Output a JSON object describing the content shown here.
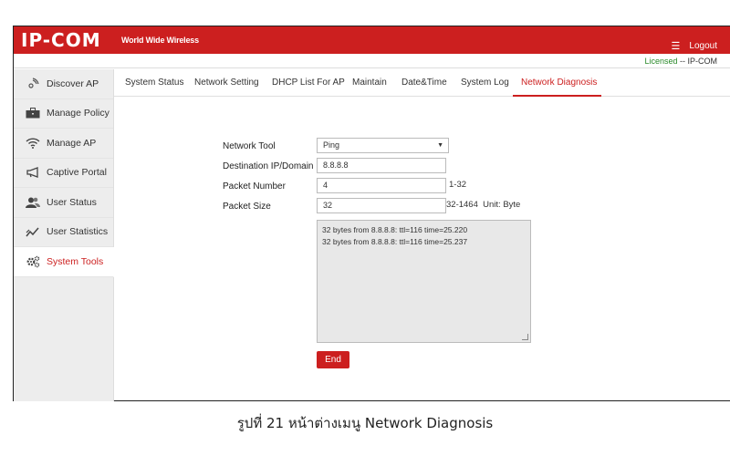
{
  "header": {
    "logo": "IP-COM",
    "tagline": "World Wide Wireless",
    "menu_icon": "hamburger-icon",
    "logout": "Logout"
  },
  "license": {
    "label": "Licensed",
    "separator": "--",
    "brand": "IP-COM"
  },
  "sidebar": {
    "items": [
      {
        "label": "Discover AP",
        "icon": "discover-ap-icon"
      },
      {
        "label": "Manage Policy",
        "icon": "briefcase-icon"
      },
      {
        "label": "Manage AP",
        "icon": "wifi-icon"
      },
      {
        "label": "Captive Portal",
        "icon": "megaphone-icon"
      },
      {
        "label": "User Status",
        "icon": "users-icon"
      },
      {
        "label": "User Statistics",
        "icon": "chart-line-icon"
      },
      {
        "label": "System Tools",
        "icon": "gears-icon",
        "active": true
      }
    ]
  },
  "tabs": [
    {
      "label": "System Status"
    },
    {
      "label": "Network Setting"
    },
    {
      "label": "DHCP List For AP"
    },
    {
      "label": "Maintain"
    },
    {
      "label": "Date&Time"
    },
    {
      "label": "System Log"
    },
    {
      "label": "Network Diagnosis",
      "active": true
    }
  ],
  "form": {
    "network_tool": {
      "label": "Network Tool",
      "value": "Ping"
    },
    "destination": {
      "label": "Destination IP/Domain",
      "value": "8.8.8.8"
    },
    "packet_number": {
      "label": "Packet Number",
      "value": "4",
      "hint": "1-32"
    },
    "packet_size": {
      "label": "Packet Size",
      "value": "32",
      "hint": "32-1464  Unit: Byte"
    },
    "output_lines": [
      "32 bytes from 8.8.8.8: ttl=116 time=25.220",
      "32 bytes from 8.8.8.8: ttl=116 time=25.237"
    ],
    "end_button": "End"
  },
  "caption": "รูปที่ 21 หน้าต่างเมนู Network Diagnosis",
  "colors": {
    "brand_red": "#cc1f1f",
    "license_green": "#2a8a2a"
  }
}
